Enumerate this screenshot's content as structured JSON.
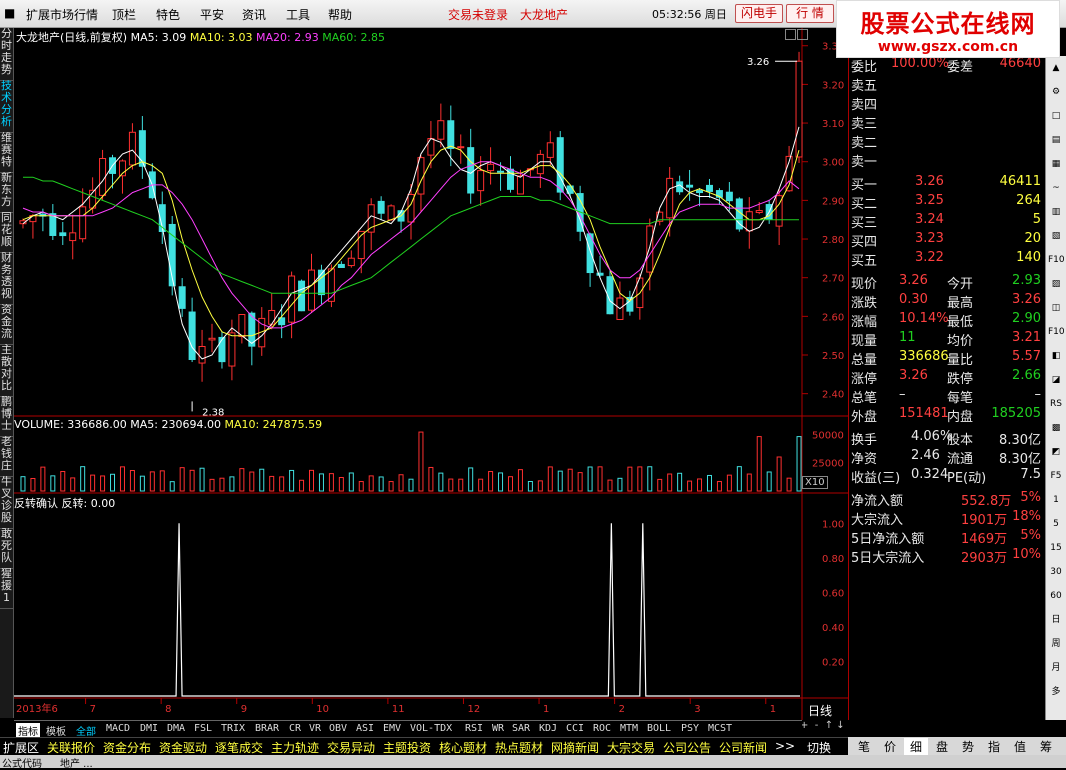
{
  "menu": {
    "items": [
      "扩展市场行情",
      "顶栏",
      "特色",
      "平安",
      "资讯",
      "工具",
      "帮助"
    ],
    "login_status": "交易未登录",
    "stock_name": "大龙地产",
    "time": "05:32:56 周日",
    "flash_btn": "闪电手",
    "quote_btn": "行 情"
  },
  "logo": {
    "title": "股票公式在线网",
    "url": "www.gszx.com.cn"
  },
  "left_tabs": [
    {
      "label": "分时走势",
      "active": false
    },
    {
      "label": "技术分析",
      "active": true
    },
    {
      "label": "维赛特",
      "active": false
    },
    {
      "label": "新东方",
      "active": false
    },
    {
      "label": "同花顺",
      "active": false
    },
    {
      "label": "财务透视",
      "active": false
    },
    {
      "label": "资金流",
      "active": false
    },
    {
      "label": "主散对比",
      "active": false
    },
    {
      "label": "鹏博士",
      "active": false
    },
    {
      "label": "老钱庄",
      "active": false
    },
    {
      "label": "牛叉诊股",
      "active": false
    },
    {
      "label": "敢死队",
      "active": false
    },
    {
      "label": "猩援1",
      "active": false
    }
  ],
  "chart_data": [
    {
      "type": "candlestick",
      "title": "大龙地产(日线,前复权)",
      "legend": [
        {
          "label": "MA5: 3.09",
          "color": "#ffffff"
        },
        {
          "label": "MA10: 3.03",
          "color": "#ffff40"
        },
        {
          "label": "MA20: 2.93",
          "color": "#ff40ff"
        },
        {
          "label": "MA60: 2.85",
          "color": "#20d020"
        }
      ],
      "yaxis_ticks": [
        "3.30",
        "3.20",
        "3.10",
        "3.00",
        "2.90",
        "2.80",
        "2.70",
        "2.60",
        "2.50",
        "2.40"
      ],
      "ylim": [
        2.35,
        3.32
      ],
      "annotations": [
        {
          "text": "3.26",
          "value": 3.26
        },
        {
          "text": "2.38",
          "value": 2.38
        }
      ],
      "series_ma": {
        "MA5": [
          2.84,
          2.86,
          2.87,
          2.86,
          2.85,
          2.87,
          2.89,
          2.92,
          2.95,
          2.99,
          3.02,
          3.03,
          3.0,
          2.94,
          2.83,
          2.7,
          2.58,
          2.52,
          2.49,
          2.5,
          2.54,
          2.57,
          2.55,
          2.53,
          2.55,
          2.58,
          2.62,
          2.66,
          2.67,
          2.68,
          2.71,
          2.74,
          2.77,
          2.8,
          2.83,
          2.86,
          2.85,
          2.84,
          2.87,
          2.93,
          3.02,
          3.06,
          3.05,
          3.01,
          2.98,
          2.97,
          2.99,
          3.0,
          2.99,
          2.97,
          2.96,
          2.98,
          3.0,
          3.0,
          2.96,
          2.91,
          2.85,
          2.77,
          2.7,
          2.64,
          2.62,
          2.64,
          2.7,
          2.78,
          2.88,
          2.93,
          2.94,
          2.92,
          2.91,
          2.91,
          2.9,
          2.87,
          2.84,
          2.82,
          2.83,
          2.87,
          2.93,
          3.0,
          3.09
        ],
        "MA10": [
          2.85,
          2.86,
          2.86,
          2.86,
          2.86,
          2.86,
          2.86,
          2.88,
          2.91,
          2.94,
          2.97,
          2.99,
          3.0,
          2.99,
          2.97,
          2.9,
          2.8,
          2.72,
          2.65,
          2.6,
          2.56,
          2.55,
          2.55,
          2.55,
          2.56,
          2.57,
          2.6,
          2.63,
          2.66,
          2.68,
          2.7,
          2.72,
          2.75,
          2.78,
          2.81,
          2.83,
          2.84,
          2.85,
          2.86,
          2.89,
          2.95,
          3.0,
          3.03,
          3.04,
          3.03,
          3.0,
          2.98,
          2.97,
          2.97,
          2.97,
          2.97,
          2.98,
          2.99,
          2.99,
          2.97,
          2.94,
          2.9,
          2.85,
          2.78,
          2.72,
          2.66,
          2.64,
          2.66,
          2.7,
          2.76,
          2.83,
          2.89,
          2.92,
          2.93,
          2.92,
          2.91,
          2.89,
          2.87,
          2.85,
          2.85,
          2.86,
          2.89,
          2.94,
          3.03
        ],
        "MA20": [
          2.88,
          2.87,
          2.87,
          2.86,
          2.86,
          2.86,
          2.86,
          2.86,
          2.87,
          2.88,
          2.9,
          2.92,
          2.93,
          2.94,
          2.94,
          2.92,
          2.89,
          2.85,
          2.8,
          2.75,
          2.7,
          2.66,
          2.63,
          2.6,
          2.58,
          2.57,
          2.57,
          2.58,
          2.59,
          2.61,
          2.63,
          2.65,
          2.68,
          2.7,
          2.73,
          2.76,
          2.78,
          2.8,
          2.82,
          2.84,
          2.87,
          2.9,
          2.93,
          2.96,
          2.98,
          2.99,
          3.0,
          3.0,
          2.99,
          2.98,
          2.97,
          2.96,
          2.96,
          2.95,
          2.93,
          2.9,
          2.86,
          2.81,
          2.76,
          2.72,
          2.7,
          2.7,
          2.72,
          2.76,
          2.8,
          2.84,
          2.87,
          2.88,
          2.89,
          2.89,
          2.89,
          2.88,
          2.88,
          2.88,
          2.89,
          2.9,
          2.92,
          2.95,
          2.93
        ],
        "MA60": [
          2.96,
          2.96,
          2.95,
          2.95,
          2.94,
          2.93,
          2.92,
          2.91,
          2.9,
          2.89,
          2.88,
          2.87,
          2.86,
          2.85,
          2.83,
          2.81,
          2.79,
          2.77,
          2.75,
          2.73,
          2.71,
          2.7,
          2.69,
          2.68,
          2.67,
          2.66,
          2.66,
          2.66,
          2.66,
          2.66,
          2.66,
          2.66,
          2.67,
          2.68,
          2.69,
          2.7,
          2.72,
          2.74,
          2.76,
          2.78,
          2.8,
          2.82,
          2.84,
          2.86,
          2.87,
          2.88,
          2.89,
          2.9,
          2.91,
          2.91,
          2.91,
          2.91,
          2.9,
          2.9,
          2.89,
          2.88,
          2.87,
          2.86,
          2.85,
          2.84,
          2.84,
          2.84,
          2.84,
          2.84,
          2.85,
          2.85,
          2.85,
          2.85,
          2.85,
          2.85,
          2.85,
          2.85,
          2.85,
          2.85,
          2.85,
          2.85,
          2.85,
          2.85,
          2.85
        ]
      }
    },
    {
      "type": "bar",
      "title": "VOLUME: 336686.00",
      "legend": [
        {
          "label": "MA5: 230694.00",
          "color": "#ffffff"
        },
        {
          "label": "MA10: 247875.59",
          "color": "#ffff40"
        }
      ],
      "yaxis_ticks": [
        "50000",
        "25000"
      ],
      "unit_label": "X10",
      "ylim": [
        0,
        60000
      ]
    },
    {
      "type": "line",
      "title": "反转确认 反转: 0.00",
      "yaxis_ticks": [
        "1.00",
        "0.80",
        "0.60",
        "0.40",
        "0.20"
      ],
      "ylim": [
        0,
        1.1
      ],
      "x_labels": [
        "2013年6",
        "7",
        "8",
        "9",
        "10",
        "11",
        "12",
        "1",
        "2",
        "3",
        "1"
      ],
      "spikes_at_fraction": [
        0.21,
        0.76,
        0.8
      ],
      "values_description": "0 everywhere except three spikes reaching 1.00"
    }
  ],
  "period_label": "日线",
  "quote": {
    "weibi": {
      "label": "委比",
      "value": "100.00%",
      "label2": "委差",
      "value2": "46640"
    },
    "sell": [
      {
        "label": "卖五"
      },
      {
        "label": "卖四"
      },
      {
        "label": "卖三"
      },
      {
        "label": "卖二"
      },
      {
        "label": "卖一"
      }
    ],
    "buy": [
      {
        "label": "买一",
        "price": "3.26",
        "vol": "46411"
      },
      {
        "label": "买二",
        "price": "3.25",
        "vol": "264"
      },
      {
        "label": "买三",
        "price": "3.24",
        "vol": "5"
      },
      {
        "label": "买四",
        "price": "3.23",
        "vol": "20"
      },
      {
        "label": "买五",
        "price": "3.22",
        "vol": "140"
      }
    ],
    "stats": [
      {
        "l1": "现价",
        "v1": "3.26",
        "c1": "red",
        "l2": "今开",
        "v2": "2.93",
        "c2": "grn"
      },
      {
        "l1": "涨跌",
        "v1": "0.30",
        "c1": "red",
        "l2": "最高",
        "v2": "3.26",
        "c2": "red"
      },
      {
        "l1": "涨幅",
        "v1": "10.14%",
        "c1": "red",
        "l2": "最低",
        "v2": "2.90",
        "c2": "grn"
      },
      {
        "l1": "现量",
        "v1": "11",
        "c1": "grn",
        "l2": "均价",
        "v2": "3.21",
        "c2": "red"
      },
      {
        "l1": "总量",
        "v1": "336686",
        "c1": "yel",
        "l2": "量比",
        "v2": "5.57",
        "c2": "red"
      },
      {
        "l1": "涨停",
        "v1": "3.26",
        "c1": "red",
        "l2": "跌停",
        "v2": "2.66",
        "c2": "grn"
      },
      {
        "l1": "总笔",
        "v1": "–",
        "c1": "wht",
        "l2": "每笔",
        "v2": "–",
        "c2": "wht"
      },
      {
        "l1": "外盘",
        "v1": "151481",
        "c1": "red",
        "l2": "内盘",
        "v2": "185205",
        "c2": "grn"
      }
    ],
    "stats2": [
      {
        "l1": "换手",
        "v1": "4.06%",
        "l2": "股本",
        "v2": "8.30亿"
      },
      {
        "l1": "净资",
        "v1": "2.46",
        "l2": "流通",
        "v2": "8.30亿"
      },
      {
        "l1": "收益(三)",
        "v1": "0.324",
        "l2": "PE(动)",
        "v2": "7.5"
      }
    ],
    "flows": [
      {
        "label": "净流入额",
        "value": "552.8万",
        "pct": "5%"
      },
      {
        "label": "大宗流入",
        "value": "1901万",
        "pct": "18%"
      },
      {
        "label": "5日净流入额",
        "value": "1469万",
        "pct": "5%"
      },
      {
        "label": "5日大宗流入",
        "value": "2903万",
        "pct": "10%"
      }
    ]
  },
  "right_icons": [
    "▲",
    "⚙",
    "□",
    "▤",
    "▦",
    "~",
    "▥",
    "▧",
    "F10",
    "▨",
    "◫",
    "F10",
    "◧",
    "◪",
    "RS",
    "▩",
    "◩",
    "F5",
    "1",
    "5",
    "15",
    "30",
    "60",
    "日",
    "周",
    "月",
    "多"
  ],
  "indicator_tabs": [
    "指标",
    "模板",
    "全部",
    "MACD",
    "DMI",
    "DMA",
    "FSL",
    "TRIX",
    "BRAR",
    "CR",
    "VR",
    "OBV",
    "ASI",
    "EMV",
    "VOL-TDX",
    "RSI",
    "WR",
    "SAR",
    "KDJ",
    "CCI",
    "ROC",
    "MTM",
    "BOLL",
    "PSY",
    "MCST"
  ],
  "info_tabs": [
    "扩展区",
    "关联报价",
    "资金分布",
    "资金驱动",
    "逐笔成交",
    "主力轨迹",
    "交易异动",
    "主题投资",
    "核心题材",
    "热点题材",
    "网摘新闻",
    "大宗交易",
    "公司公告",
    "公司新闻",
    ">>",
    "切换"
  ],
  "bottom_tabs": [
    "笔",
    "价",
    "细",
    "盘",
    "势",
    "指",
    "值",
    "筹"
  ],
  "status": {
    "left": "公式代码",
    "mid": "地产 ..."
  }
}
